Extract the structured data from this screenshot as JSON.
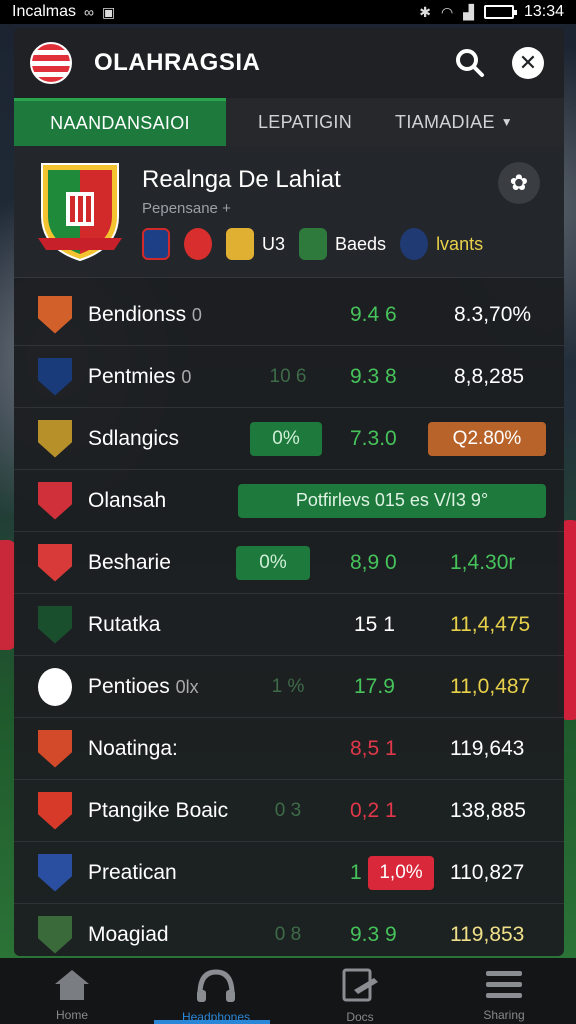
{
  "status_bar": {
    "left_text": "Incalmas",
    "time": "13:34"
  },
  "app": {
    "title": "OLAHRAGSIA"
  },
  "tabs": [
    {
      "label": "NAANDANSAIOI",
      "active": true
    },
    {
      "label": "LEPATIGIN",
      "active": false
    },
    {
      "label": "TIAMADIAE",
      "active": false,
      "has_dropdown": true
    }
  ],
  "team": {
    "name": "Realnga De Lahiat",
    "subtitle": "Pepensane +",
    "badges": [
      {
        "label": "",
        "color": "#1c3f86"
      },
      {
        "label": "",
        "color": "#d82e2e"
      },
      {
        "label": "U3",
        "color": "#e0b032"
      },
      {
        "label": "Baeds",
        "color": "#2e7a3c"
      },
      {
        "label": "lvants",
        "color": "#203a74"
      }
    ]
  },
  "rows": [
    {
      "name": "Bendionss",
      "suffix": "0",
      "pill": "",
      "mid": "9.4 6",
      "mid_color": "green",
      "right": "8.3,70%",
      "right_color": "white-yellow",
      "crest": "#d2602a"
    },
    {
      "name": "Pentmies",
      "suffix": "0",
      "pill": "10 6",
      "pill_style": "dim",
      "mid": "9.3 8",
      "mid_color": "green",
      "right": "8,8,285",
      "right_color": "white-yellow",
      "crest": "#1a3b7a"
    },
    {
      "name": "Sdlangics",
      "suffix": "",
      "pill": "0%",
      "pill_style": "green",
      "mid": "7.3.0",
      "mid_color": "green",
      "right": "Q2.80%",
      "right_style": "orange-pill",
      "crest": "#b8902a"
    },
    {
      "name": "Olansah",
      "suffix": "",
      "pill": "Potfirlevs 015 es V/I3 9°",
      "pill_style": "wide-green",
      "mid": "",
      "right": "",
      "crest": "#d0303a"
    },
    {
      "name": "Besharie",
      "suffix": "",
      "pill": "0%",
      "pill_style": "green",
      "mid": "8,9 0",
      "mid_color": "green",
      "right": "1,4.30r",
      "right_color": "green",
      "crest": "#d83a3a"
    },
    {
      "name": "Rutatka",
      "suffix": "",
      "pill": "",
      "mid": "15 1",
      "mid_color": "white",
      "right": "11,4,475",
      "right_color": "yellow",
      "crest": "#1a4f2e"
    },
    {
      "name": "Pentioes",
      "suffix": "0lx",
      "pill": "1 %",
      "pill_style": "dim",
      "mid": "17.9",
      "mid_color": "green",
      "right": "11,0,487",
      "right_color": "yellow",
      "crest": "#ffffff"
    },
    {
      "name": "Noatinga:",
      "suffix": "",
      "pill": "",
      "mid": "8,5 1",
      "mid_color": "red",
      "right": "119,643",
      "right_color": "white",
      "crest": "#d24a2a"
    },
    {
      "name": "Ptangike Boaic",
      "suffix": "",
      "pill": "0 3",
      "pill_style": "dim",
      "mid": "0,2 1",
      "mid_color": "red",
      "right": "138,885",
      "right_color": "white-yellow",
      "crest": "#d83a2a"
    },
    {
      "name": "Preatican",
      "suffix": "",
      "pill": "1,0%",
      "pill_style": "red",
      "mid": "1",
      "mid_color": "green",
      "right": "110,827",
      "right_color": "white-yellow",
      "crest": "#2a4fa0"
    },
    {
      "name": "Moagiad",
      "suffix": "",
      "pill": "0 8",
      "pill_style": "dim",
      "mid": "9.3 9",
      "mid_color": "green",
      "right": "119,853",
      "right_color": "white-yellow",
      "crest": "#3a6a3a"
    }
  ],
  "bottom_nav": [
    {
      "label": "Home",
      "icon": "home-icon"
    },
    {
      "label": "Headphones",
      "icon": "headphones-icon"
    },
    {
      "label": "Docs",
      "icon": "document-icon"
    },
    {
      "label": "Sharing",
      "icon": "menu-icon"
    }
  ],
  "colors": {
    "accent_green": "#1e7a3c",
    "panel": "#1c1e21"
  }
}
